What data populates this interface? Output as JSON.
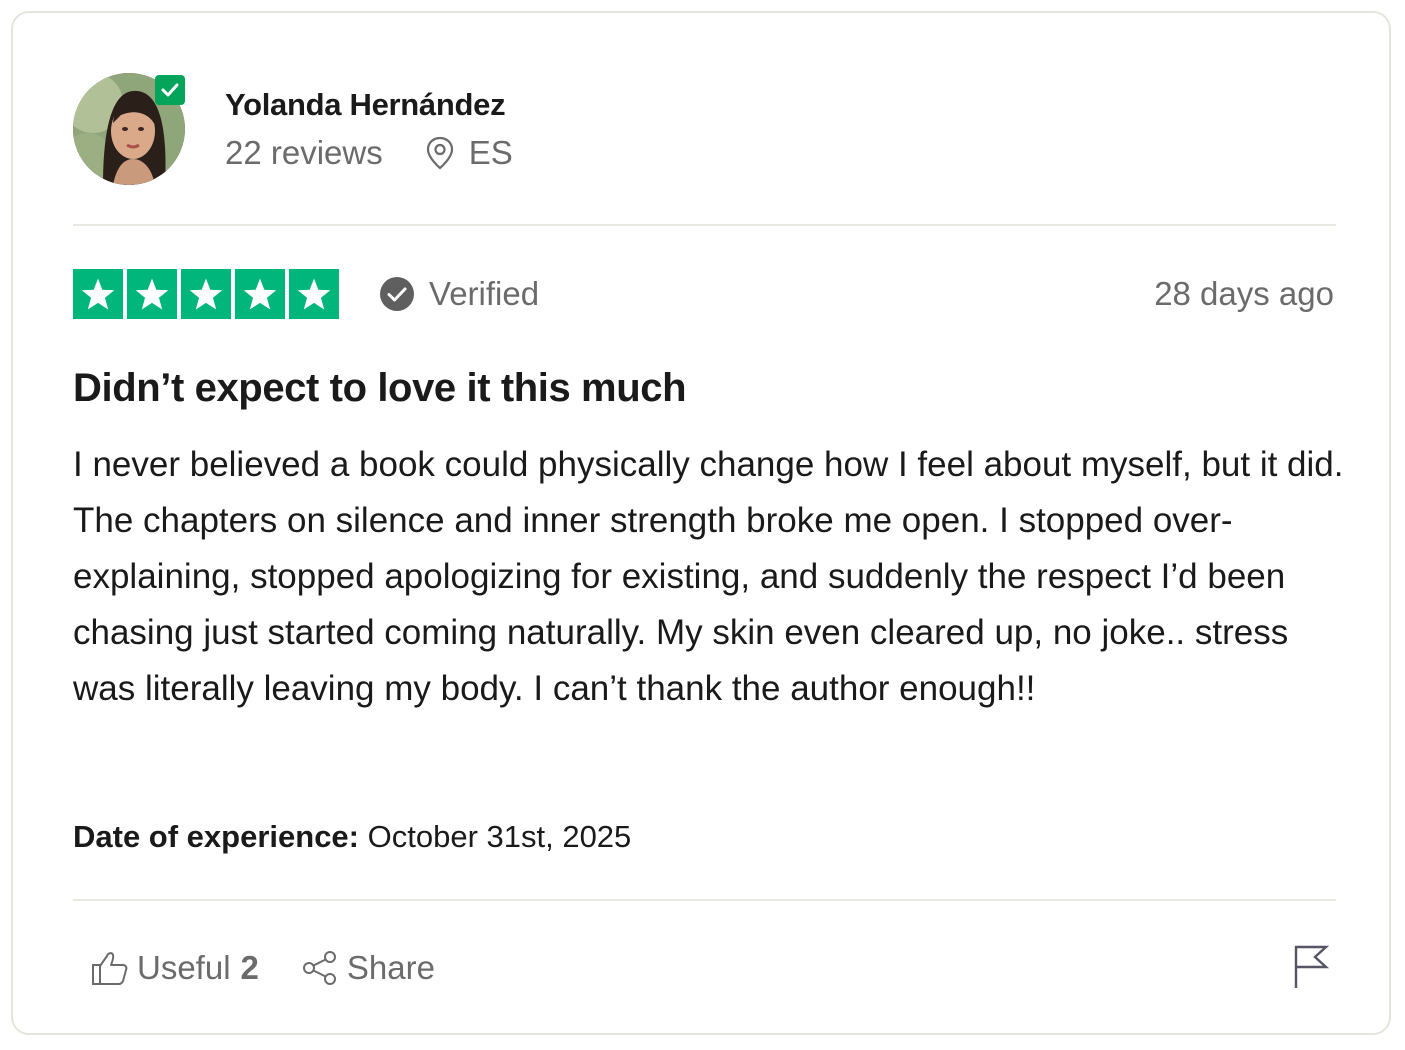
{
  "reviewer": {
    "name": "Yolanda Hernández",
    "review_count": "22 reviews",
    "country": "ES",
    "verified_profile": true
  },
  "rating": {
    "stars": 5,
    "max_stars": 5,
    "star_color": "#00b67a"
  },
  "verified_label": "Verified",
  "posted_ago": "28 days ago",
  "review": {
    "title": "Didn’t expect to love it this much",
    "body": "I never believed a book could physically change how I feel about myself, but it did. The chapters on silence and inner strength broke me open. I stopped over-explaining, stopped apologizing for existing, and suddenly the respect I’d been chasing just started coming naturally. My skin even cleared up, no joke.. stress was literally leaving my body. I can’t thank the author enough!!"
  },
  "experience": {
    "label": "Date of experience:",
    "date": "October 31st, 2025"
  },
  "actions": {
    "useful_label": "Useful",
    "useful_count": "2",
    "share_label": "Share"
  },
  "icons": {
    "avatar_badge": "check-icon",
    "location": "location-pin-icon",
    "verified": "check-circle-icon",
    "useful": "thumbs-up-icon",
    "share": "share-icon",
    "report": "flag-icon"
  },
  "colors": {
    "brand_green": "#00b67a",
    "badge_green": "#04a45a",
    "muted_text": "#6b6b6b",
    "divider": "#e8e8e2"
  }
}
